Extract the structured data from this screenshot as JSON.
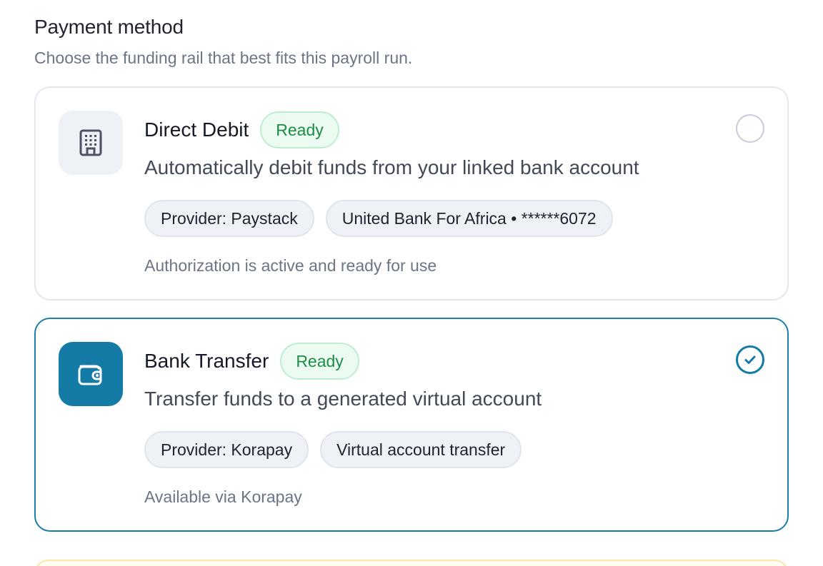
{
  "header": {
    "title": "Payment method",
    "subtitle": "Choose the funding rail that best fits this payroll run."
  },
  "options": [
    {
      "title": "Direct Debit",
      "status": "Ready",
      "description": "Automatically debit funds from your linked bank account",
      "chips": [
        "Provider: Paystack",
        "United Bank For Africa • ******6072"
      ],
      "note": "Authorization is active and ready for use",
      "icon": "building-icon",
      "selected": false
    },
    {
      "title": "Bank Transfer",
      "status": "Ready",
      "description": "Transfer funds to a generated virtual account",
      "chips": [
        "Provider: Korapay",
        "Virtual account transfer"
      ],
      "note": "Available via Korapay",
      "icon": "wallet-icon",
      "selected": true
    }
  ],
  "colors": {
    "accent": "#137ba6",
    "ready_text": "#1f8a47",
    "ready_bg": "#ecfbf2"
  }
}
